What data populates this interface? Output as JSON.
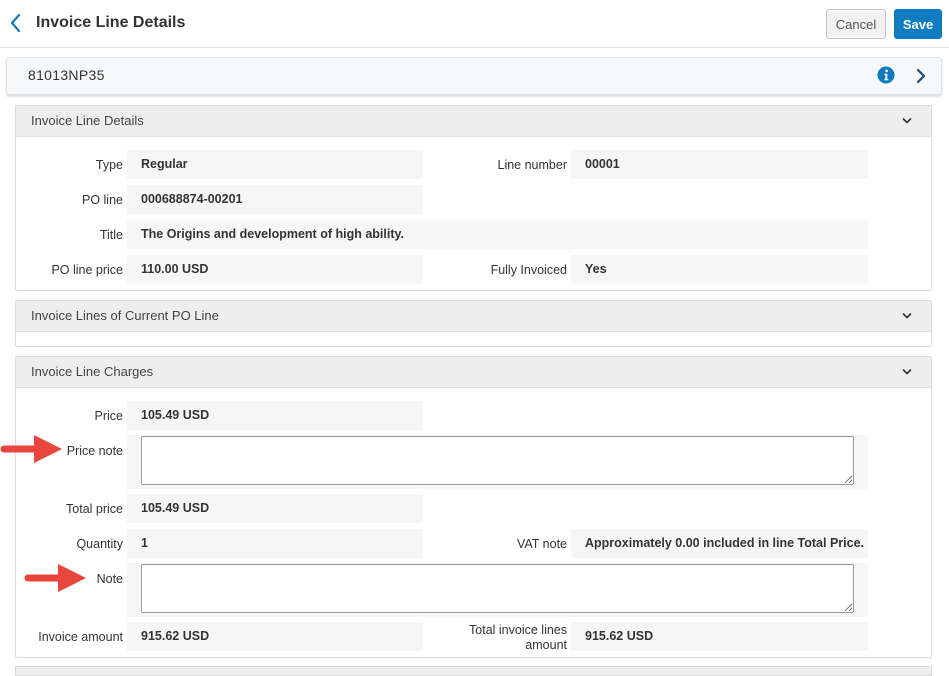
{
  "header": {
    "title": "Invoice Line Details",
    "cancel_label": "Cancel",
    "save_label": "Save"
  },
  "record": {
    "id": "81013NP35"
  },
  "details": {
    "title": "Invoice Line Details",
    "type_label": "Type",
    "type_value": "Regular",
    "line_number_label": "Line number",
    "line_number_value": "00001",
    "po_line_label": "PO line",
    "po_line_value": "000688874-00201",
    "title_label": "Title",
    "title_value": "The Origins and development of high ability.",
    "po_line_price_label": "PO line price",
    "po_line_price_value": "110.00 USD",
    "fully_invoiced_label": "Fully Invoiced",
    "fully_invoiced_value": "Yes"
  },
  "current_po_lines": {
    "title": "Invoice Lines of Current PO Line"
  },
  "charges": {
    "title": "Invoice Line Charges",
    "price_label": "Price",
    "price_value": "105.49 USD",
    "price_note_label": "Price note",
    "price_note_value": "",
    "total_price_label": "Total price",
    "total_price_value": "105.49 USD",
    "quantity_label": "Quantity",
    "quantity_value": "1",
    "vat_note_label": "VAT note",
    "vat_note_value": "Approximately 0.00 included in line Total Price.",
    "note_label": "Note",
    "note_value": "",
    "invoice_amount_label": "Invoice amount",
    "invoice_amount_value": "915.62 USD",
    "total_lines_label_1": "Total invoice lines",
    "total_lines_label_2": "amount",
    "total_lines_value": "915.62 USD"
  },
  "colors": {
    "accent": "#0f7cc1",
    "annotation_arrow": "#e8453c"
  },
  "icons": [
    "chevron-left-icon",
    "info-icon",
    "chevron-right-icon",
    "chevron-down-icon",
    "red-arrow-annotation"
  ]
}
